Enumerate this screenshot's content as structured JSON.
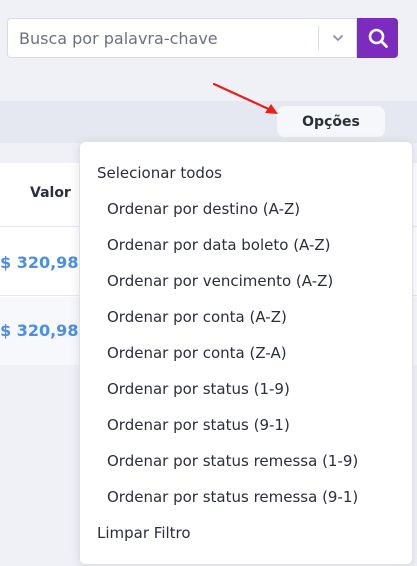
{
  "search": {
    "placeholder": "Busca por palavra-chave",
    "value": ""
  },
  "toolbar": {
    "options_label": "Opções",
    "annotation_color": "#e8201c"
  },
  "table": {
    "columns": [
      "Valor"
    ],
    "rows": [
      {
        "valor": "$ 320,98"
      },
      {
        "valor": "$ 320,98"
      }
    ]
  },
  "menu": {
    "select_all": "Selecionar todos",
    "items": [
      "Ordenar por destino (A-Z)",
      "Ordenar por data boleto (A-Z)",
      "Ordenar por vencimento (A-Z)",
      "Ordenar por conta (A-Z)",
      "Ordenar por conta (Z-A)",
      "Ordenar por status (1-9)",
      "Ordenar por status (9-1)",
      "Ordenar por status remessa (1-9)",
      "Ordenar por status remessa (9-1)"
    ],
    "clear": "Limpar Filtro"
  },
  "colors": {
    "accent": "#7b2cbf",
    "value_link": "#4a8fe7",
    "background": "#f0f1f7"
  },
  "icons": {
    "search": "search-icon",
    "dropdown": "chevron-down-icon"
  }
}
